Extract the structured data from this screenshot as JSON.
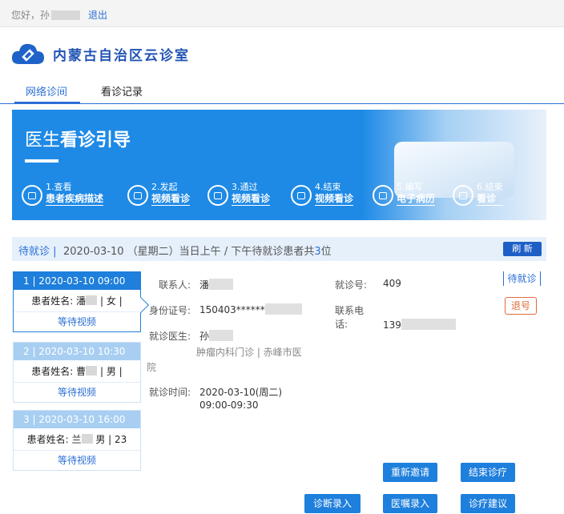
{
  "topbar": {
    "greeting": "您好，孙",
    "logout": "退出"
  },
  "logo": {
    "title": "内蒙古自治区云诊室"
  },
  "nav": {
    "tabs": [
      {
        "label": "网络诊间"
      },
      {
        "label": "看诊记录"
      }
    ]
  },
  "banner": {
    "title_light": "医生",
    "title_bold": "看诊引导",
    "steps": [
      {
        "l1": "1.查看",
        "l2": "患者疾病描述"
      },
      {
        "l1": "2.发起",
        "l2": "视频看诊"
      },
      {
        "l1": "3.通过",
        "l2": "视频看诊"
      },
      {
        "l1": "4.结束",
        "l2": "视频看诊"
      },
      {
        "l1": "5.编写",
        "l2": "电子病历"
      },
      {
        "l1": "6.结束",
        "l2": "看诊"
      }
    ]
  },
  "status": {
    "label": "待就诊",
    "sep": " | ",
    "text": "2020-03-10 （星期二）当日上午 / 下午待就诊患者共",
    "count": "3",
    "unit": "位",
    "refresh": "刷 新"
  },
  "queue": [
    {
      "header": "1 | 2020-03-10 09:00",
      "name_prefix": "患者姓名: 潘",
      "name_suffix": "| 女 |",
      "wait": "等待视频"
    },
    {
      "header": "2 | 2020-03-10 10:30",
      "name_prefix": "患者姓名: 曹",
      "name_suffix": "| 男 |",
      "wait": "等待视频"
    },
    {
      "header": "3 | 2020-03-10 16:00",
      "name_prefix": "患者姓名: 兰",
      "name_suffix": "男 | 23",
      "wait": "等待视频"
    }
  ],
  "detail": {
    "contact_label": "联系人:",
    "contact_value": "潘",
    "visit_no_label": "就诊号:",
    "visit_no_value": "409",
    "id_label": "身份证号:",
    "id_value": "150403******",
    "phone_label1": "联系电",
    "phone_label2": "话:",
    "phone_value": "139",
    "doctor_label": "就诊医生:",
    "doctor_value": "孙",
    "dept_line1": "肿瘤内科门诊 | 赤峰市医",
    "dept_line2": "院",
    "time_label": "就诊时间:",
    "time_value1": "2020-03-10(周二)",
    "time_value2": "09:00-09:30",
    "status_tag": "待就诊",
    "withdraw": "退号"
  },
  "actions": {
    "reinvite": "重新邀请",
    "end": "结束诊疗",
    "diagnosis": "诊断录入",
    "orders": "医嘱录入",
    "advice": "诊疗建议"
  }
}
